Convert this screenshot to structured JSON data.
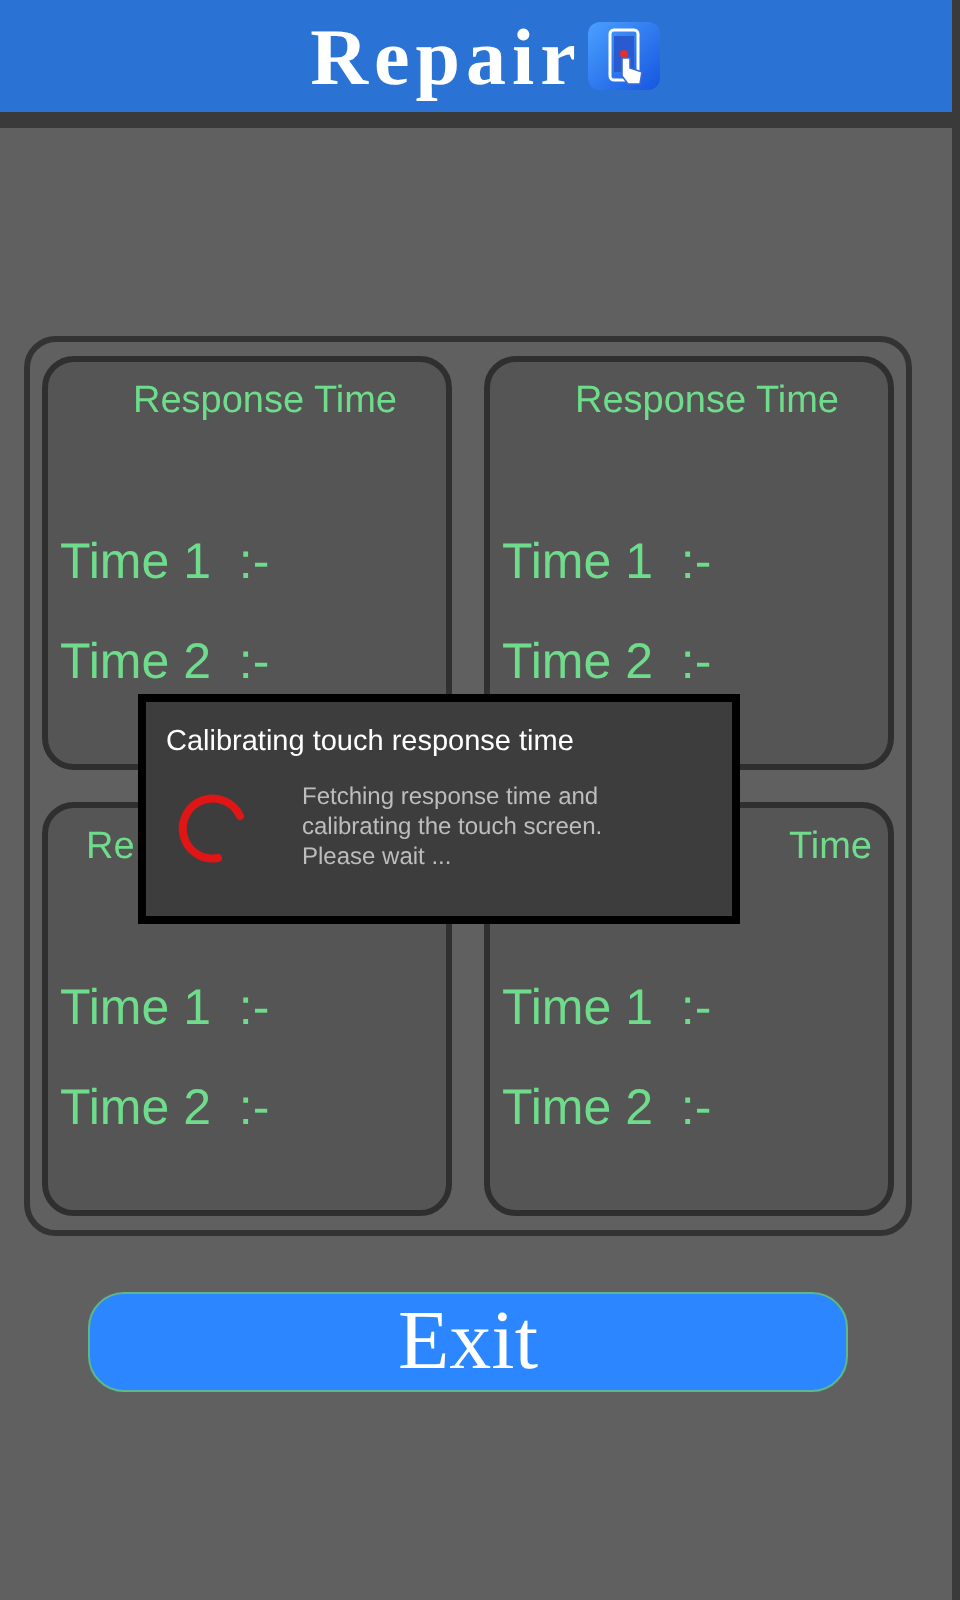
{
  "header": {
    "title": "Repair"
  },
  "cards": [
    {
      "title": "Response Time",
      "time_1": "Time 1  :-",
      "time_2": "Time 2  :-"
    },
    {
      "title": "Response Time",
      "time_1": "Time 1  :-",
      "time_2": "Time 2  :-"
    },
    {
      "title": "Re",
      "time_1": "Time 1  :-",
      "time_2": "Time 2  :-"
    },
    {
      "title": "Time",
      "time_1": "Time 1  :-",
      "time_2": "Time 2  :-"
    }
  ],
  "exit_button": {
    "label": "Exit"
  },
  "dialog": {
    "title": "Calibrating touch response time",
    "message": "Fetching response time and calibrating the touch screen. Please wait ..."
  }
}
